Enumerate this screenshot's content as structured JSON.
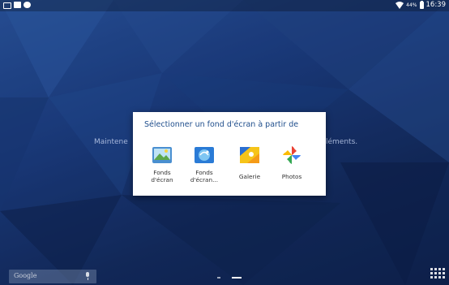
{
  "status_bar": {
    "battery_percent": "44%",
    "time": "16:39",
    "left_icons": [
      "tablet-icon",
      "image-icon",
      "camera-icon"
    ],
    "right_icons": [
      "wifi-icon",
      "battery-icon"
    ]
  },
  "home_hint": {
    "left_text": "Maintene",
    "right_text": "léments."
  },
  "dialog": {
    "title": "Sélectionner un fond d'écran à partir de",
    "options": [
      {
        "label": "Fonds\nd'écran",
        "icon": "wallpapers-icon"
      },
      {
        "label": "Fonds\nd'écran...",
        "icon": "live-wallpapers-icon"
      },
      {
        "label": "Galerie",
        "icon": "gallery-icon"
      },
      {
        "label": "Photos",
        "icon": "photos-icon"
      }
    ]
  },
  "bottom_bar": {
    "search_label": "Google",
    "page_indicator": {
      "count": 2,
      "active": 2
    }
  }
}
